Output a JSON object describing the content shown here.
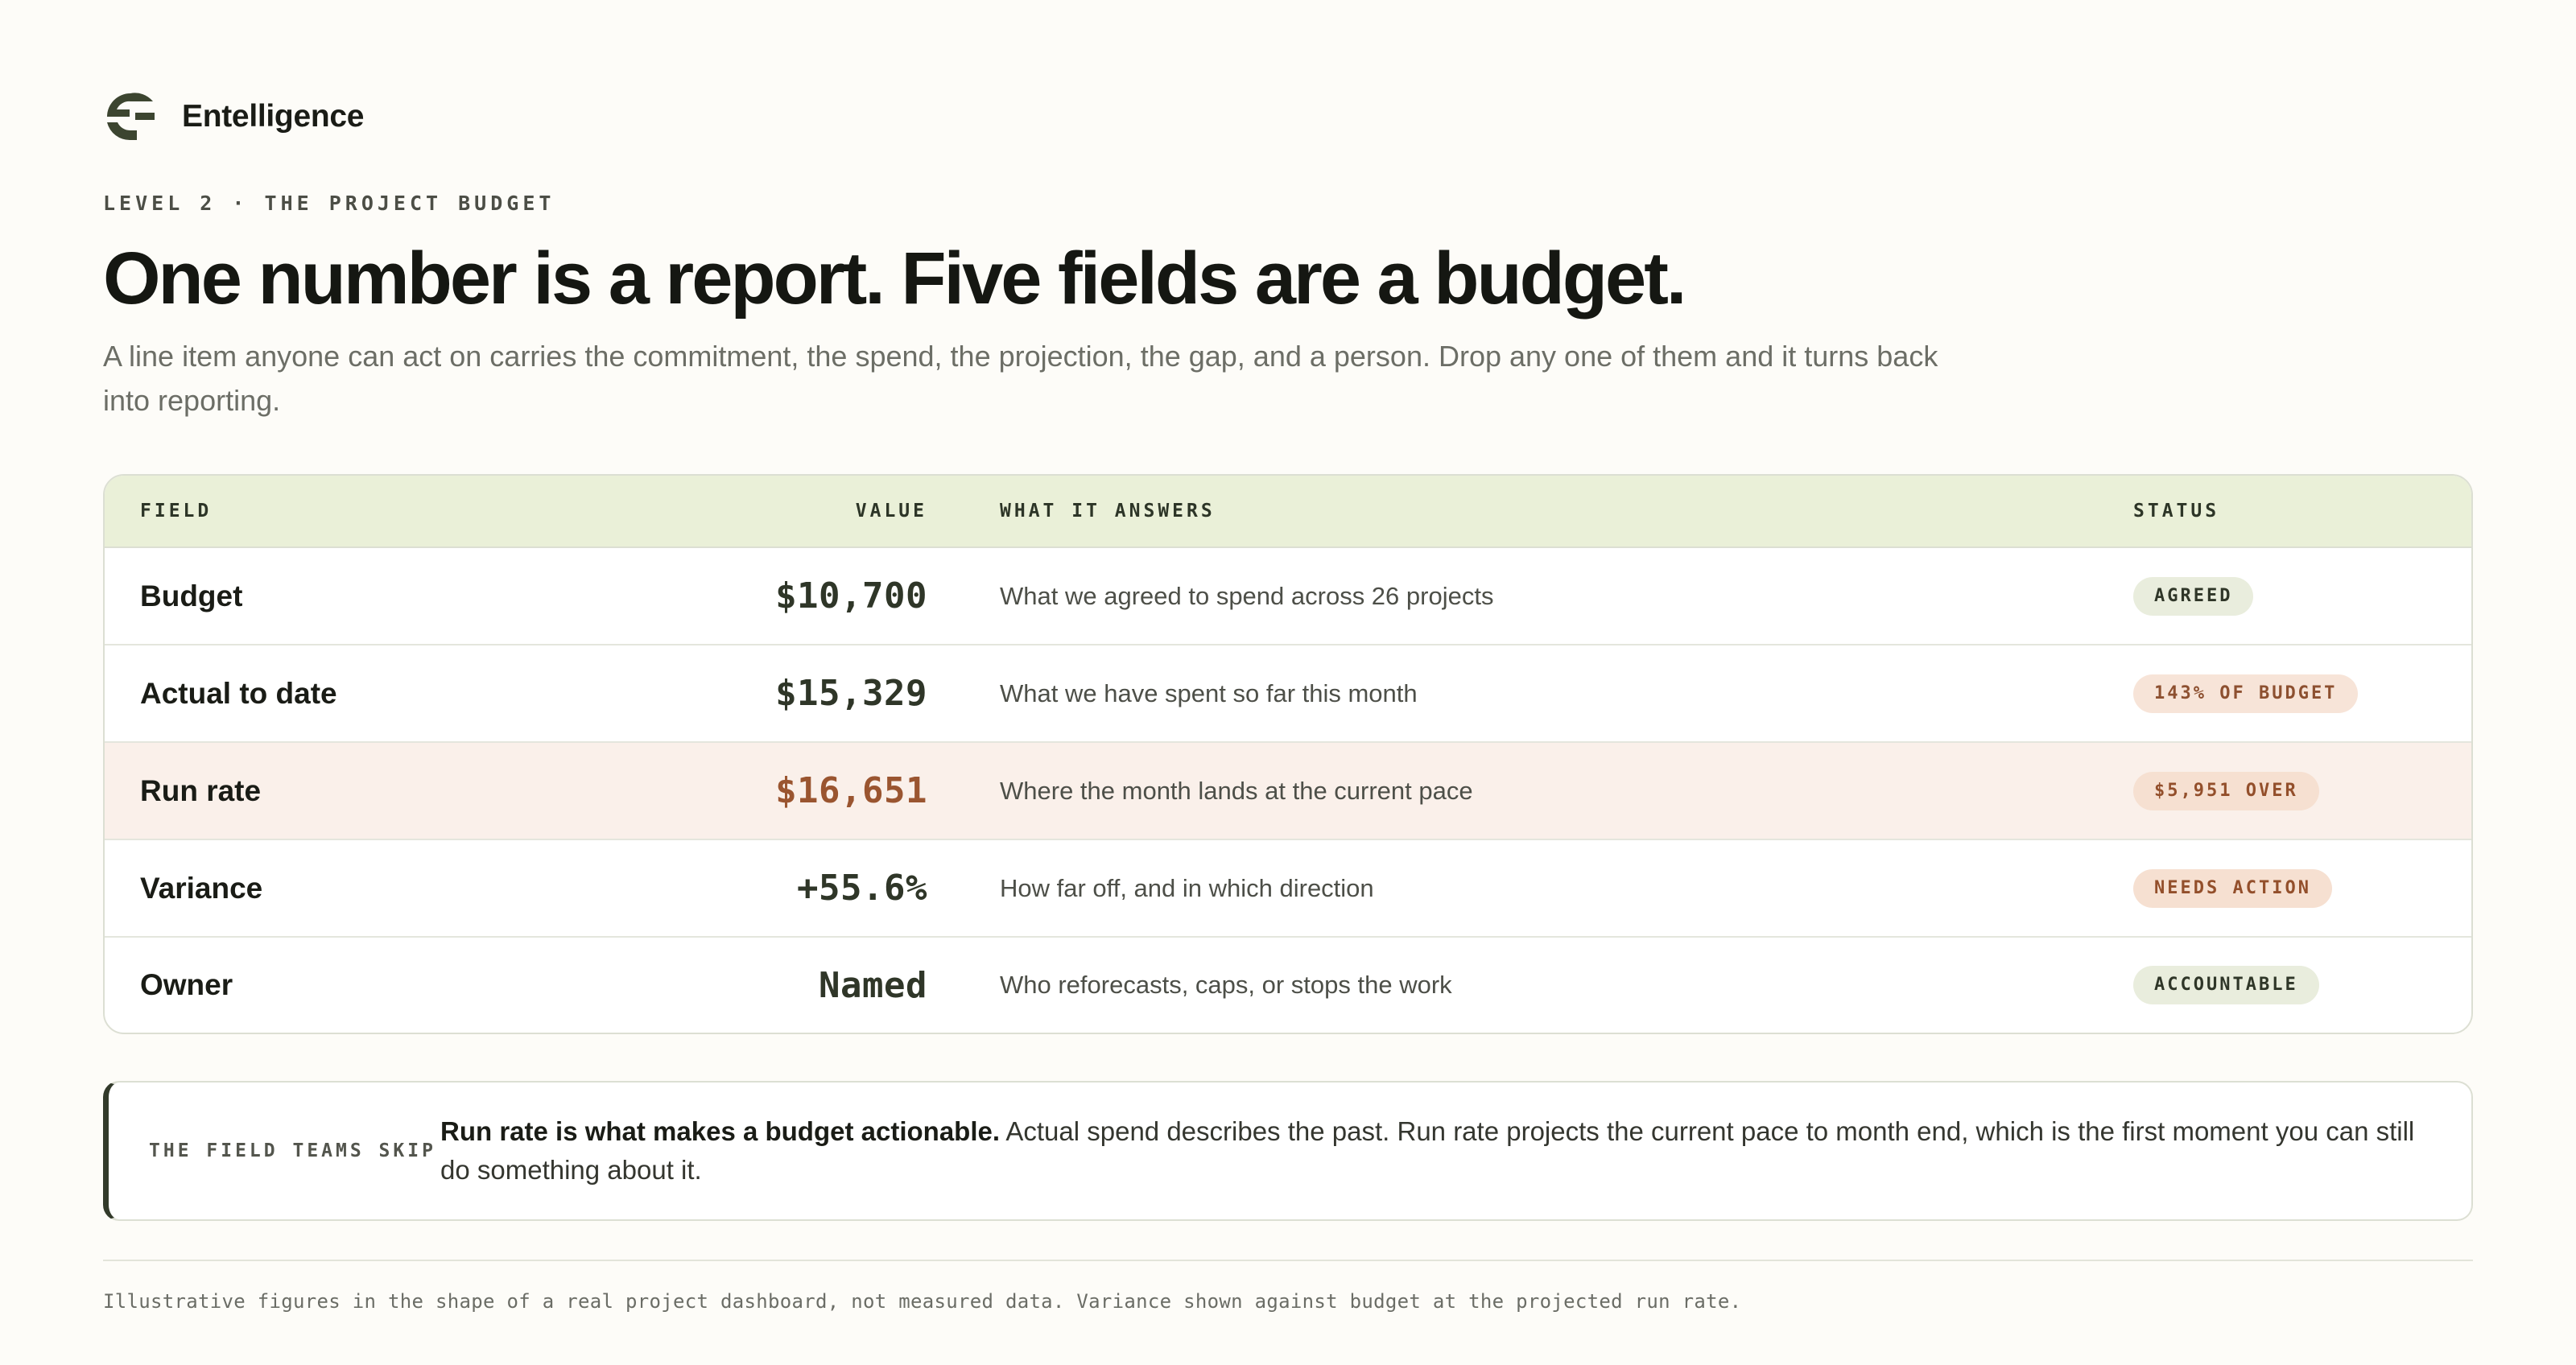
{
  "brand": {
    "name": "Entelligence",
    "logo_icon": "entelligence-logo-icon"
  },
  "header": {
    "eyebrow": "LEVEL 2 · THE PROJECT BUDGET",
    "title": "One number is a report. Five fields are a budget.",
    "lead": "A line item anyone can act on carries the commitment, the spend, the projection, the gap, and a person. Drop any one of them and it turns back into reporting."
  },
  "table": {
    "columns": [
      "FIELD",
      "VALUE",
      "WHAT IT ANSWERS",
      "STATUS"
    ],
    "rows": [
      {
        "field": "Budget",
        "value": "$10,700",
        "answer": "What we agreed to spend across 26 projects",
        "status": "AGREED"
      },
      {
        "field": "Actual to date",
        "value": "$15,329",
        "answer": "What we have spent so far this month",
        "status": "143% OF BUDGET"
      },
      {
        "field": "Run rate",
        "value": "$16,651",
        "answer": "Where the month lands at the current pace",
        "status": "$5,951 OVER"
      },
      {
        "field": "Variance",
        "value": "+55.6%",
        "answer": "How far off, and in which direction",
        "status": "NEEDS ACTION"
      },
      {
        "field": "Owner",
        "value": "Named",
        "answer": "Who reforecasts, caps, or stops the work",
        "status": "ACCOUNTABLE"
      }
    ]
  },
  "callout": {
    "label": "THE FIELD TEAMS SKIP",
    "lead": "Run rate is what makes a budget actionable.",
    "body": " Actual spend describes the past. Run rate projects the current pace to month end, which is the first moment you can still do something about it."
  },
  "footnote": "Illustrative figures in the shape of a real project dashboard, not measured data. Variance shown against budget at the projected run rate.",
  "colors": {
    "background": "#fdfcf8",
    "header_band": "#eaf0d8",
    "highlight_row": "#faf0ea",
    "accent_dark": "#323a2a",
    "warm_value": "#9a5530"
  }
}
